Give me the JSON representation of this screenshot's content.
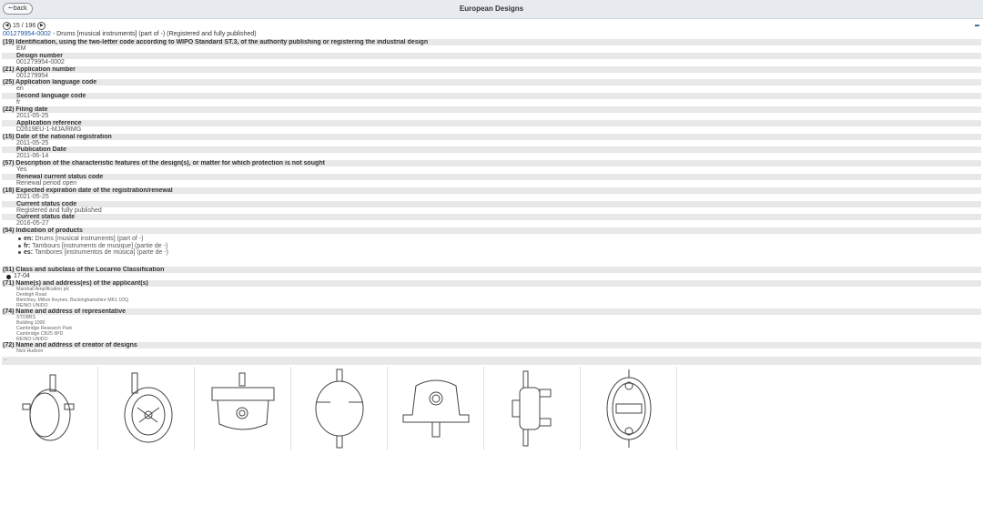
{
  "app": {
    "title": "European Designs",
    "back_label": "back"
  },
  "pager": {
    "text": "15 / 196"
  },
  "heading": {
    "number": "001279954-0002",
    "rest": " - Drums [musical instruments] (part of -) (Registered and fully published)"
  },
  "fields": [
    {
      "label": "(19) Identification, using the two-letter code according to WIPO Standard ST.3, of the authority publishing or registering the industrial design",
      "value": "EM"
    },
    {
      "label": "Design number",
      "value": "001279954-0002",
      "sub": true
    },
    {
      "label": "(21) Application number",
      "value": "001279954"
    },
    {
      "label": "(25) Application language code",
      "value": "en"
    },
    {
      "label": "Second language code",
      "value": "fr",
      "sub": true
    },
    {
      "label": "(22) Filing date",
      "value": "2011-05-25"
    },
    {
      "label": "Application reference",
      "value": "D2619EU-1-MJA/RMG",
      "sub": true
    },
    {
      "label": "(15) Date of the national registration",
      "value": "2011-05-25"
    },
    {
      "label": "Publication Date",
      "value": "2011-06-14",
      "sub": true
    },
    {
      "label": "(57) Description of the characteristic features of the design(s), or matter for which protection is not sought",
      "value": "Yes"
    },
    {
      "label": "Renewal current status code",
      "value": "Renewal period open",
      "sub": true
    },
    {
      "label": "(18) Expected expiration date of the registration/renewal",
      "value": "2021-05-25"
    },
    {
      "label": "Current status code",
      "value": "Registered and fully published",
      "sub": true
    },
    {
      "label": "Current status date",
      "value": "2016-05-27",
      "sub": true
    }
  ],
  "products": {
    "label": "(54) Indication of products",
    "items": [
      {
        "lang": "en:",
        "text": " Drums [musical instruments] (part of -)"
      },
      {
        "lang": "fr:",
        "text": " Tambours [instruments de musique] (partie de -)"
      },
      {
        "lang": "es:",
        "text": " Tambores [instrumentos de música] (parte de -)"
      }
    ]
  },
  "locarno": {
    "label": "(51) Class and subclass of the Locarno Classification",
    "value": "17-04"
  },
  "applicant": {
    "label": "(71) Name(s) and address(es) of the applicant(s)",
    "lines": [
      "Marshall Amplification plc",
      "Denbigh Road",
      "Bletchley, Milton Keynes, Buckinghamshire MK1 1DQ",
      "REINO UNIDO"
    ]
  },
  "representative": {
    "label": "(74) Name and address of representative",
    "lines": [
      "STOBBS",
      "Building 1000",
      "Cambridge Research Park",
      "Cambridge CB25 9PD",
      "REINO UNIDO"
    ]
  },
  "creator": {
    "label": "(72) Name and address of creator of designs",
    "lines": [
      "Nick Hudson"
    ]
  },
  "gallery": {
    "header": "-",
    "thumbs": [
      "view-1",
      "view-2",
      "view-3",
      "view-4",
      "view-5",
      "view-6",
      "view-7"
    ]
  }
}
